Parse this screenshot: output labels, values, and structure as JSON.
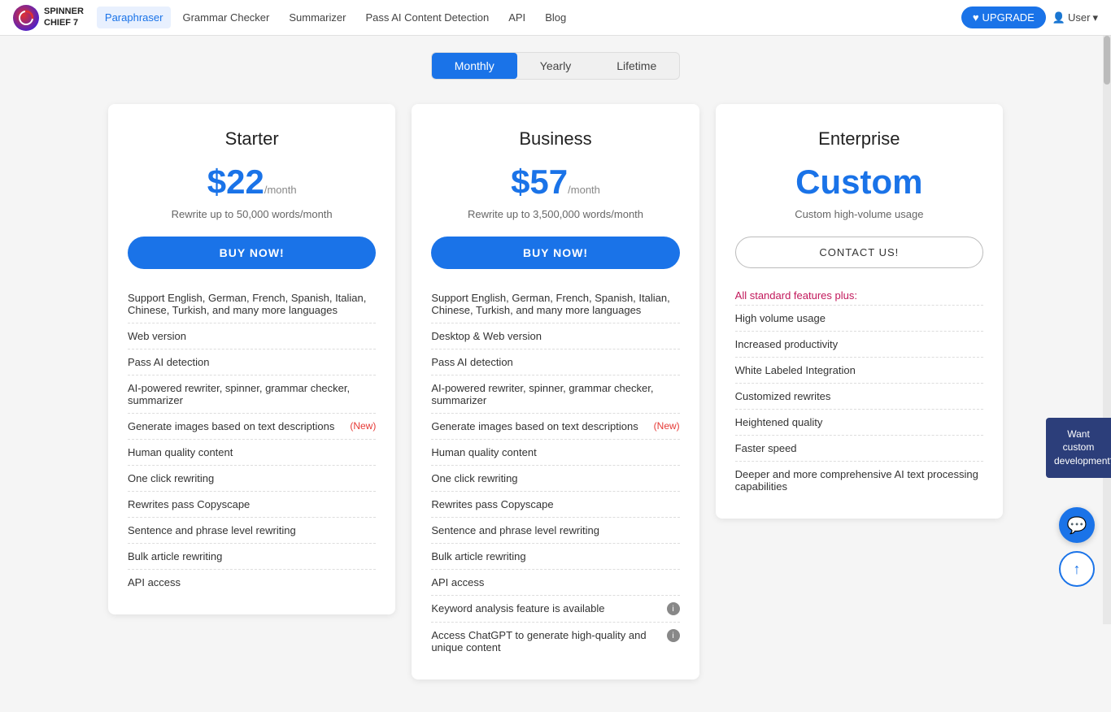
{
  "navbar": {
    "logo_line1": "SPINNER",
    "logo_line2": "CHIEF 7",
    "links": [
      {
        "label": "Paraphraser",
        "active": true
      },
      {
        "label": "Grammar Checker",
        "active": false
      },
      {
        "label": "Summarizer",
        "active": false
      },
      {
        "label": "Pass AI Content Detection",
        "active": false
      },
      {
        "label": "API",
        "active": false
      },
      {
        "label": "Blog",
        "active": false
      }
    ],
    "upgrade_label": "UPGRADE",
    "user_label": "User"
  },
  "billing_tabs": {
    "tabs": [
      {
        "label": "Monthly",
        "active": true
      },
      {
        "label": "Yearly",
        "active": false
      },
      {
        "label": "Lifetime",
        "active": false
      }
    ]
  },
  "plans": [
    {
      "name": "Starter",
      "price": "$22",
      "period": "/month",
      "subtitle": "Rewrite up to 50,000 words/month",
      "cta": "BUY NOW!",
      "cta_type": "buy",
      "features": [
        {
          "text": "Support English, German, French, Spanish, Italian, Chinese, Turkish, and many more languages",
          "new": false
        },
        {
          "text": "Web version",
          "new": false
        },
        {
          "text": "Pass AI detection",
          "new": false
        },
        {
          "text": "AI-powered rewriter, spinner, grammar checker, summarizer",
          "new": false
        },
        {
          "text": "Generate images based on text descriptions",
          "new": true,
          "new_label": "(New)"
        },
        {
          "text": "Human quality content",
          "new": false
        },
        {
          "text": "One click rewriting",
          "new": false
        },
        {
          "text": "Rewrites pass Copyscape",
          "new": false
        },
        {
          "text": "Sentence and phrase level rewriting",
          "new": false
        },
        {
          "text": "Bulk article rewriting",
          "new": false
        },
        {
          "text": "API access",
          "new": false
        }
      ]
    },
    {
      "name": "Business",
      "price": "$57",
      "period": "/month",
      "subtitle": "Rewrite up to 3,500,000 words/month",
      "cta": "BUY NOW!",
      "cta_type": "buy",
      "features": [
        {
          "text": "Support English, German, French, Spanish, Italian, Chinese, Turkish, and many more languages",
          "new": false
        },
        {
          "text": "Desktop & Web version",
          "new": false
        },
        {
          "text": "Pass AI detection",
          "new": false
        },
        {
          "text": "AI-powered rewriter, spinner, grammar checker, summarizer",
          "new": false
        },
        {
          "text": "Generate images based on text descriptions",
          "new": true,
          "new_label": "(New)"
        },
        {
          "text": "Human quality content",
          "new": false
        },
        {
          "text": "One click rewriting",
          "new": false
        },
        {
          "text": "Rewrites pass Copyscape",
          "new": false
        },
        {
          "text": "Sentence and phrase level rewriting",
          "new": false
        },
        {
          "text": "Bulk article rewriting",
          "new": false
        },
        {
          "text": "API access",
          "new": false
        },
        {
          "text": "Keyword analysis feature is available",
          "new": false,
          "info": true
        },
        {
          "text": "Access ChatGPT to generate high-quality and unique content",
          "new": false,
          "info": true
        }
      ]
    },
    {
      "name": "Enterprise",
      "price": "Custom",
      "price_type": "custom",
      "subtitle": "Custom high-volume usage",
      "cta": "CONTACT US!",
      "cta_type": "contact",
      "section_label": "All standard features plus:",
      "features": [
        {
          "text": "High volume usage",
          "new": false
        },
        {
          "text": "Increased productivity",
          "new": false
        },
        {
          "text": "White Labeled Integration",
          "new": false
        },
        {
          "text": "Customized rewrites",
          "new": false
        },
        {
          "text": "Heightened quality",
          "new": false
        },
        {
          "text": "Faster speed",
          "new": false
        },
        {
          "text": "Deeper and more comprehensive AI text processing capabilities",
          "new": false
        }
      ]
    }
  ],
  "floating": {
    "custom_dev": "Want custom development?",
    "scroll_up": "↑"
  }
}
